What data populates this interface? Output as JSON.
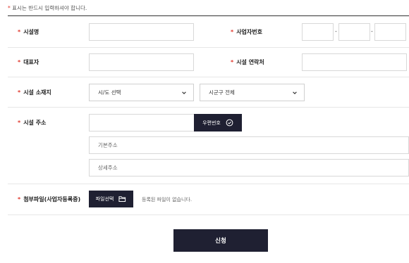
{
  "notice": {
    "star": "*",
    "text": " 표시는 반드시 입력하셔야 합니다."
  },
  "required_mark": "*",
  "fields": {
    "facility_name": {
      "label": "시설명",
      "value": ""
    },
    "business_number": {
      "label": "사업자번호",
      "part1": "",
      "part2": "",
      "part3": "",
      "separator": "-"
    },
    "representative": {
      "label": "대표자",
      "value": ""
    },
    "facility_contact": {
      "label": "시설 연락처",
      "value": ""
    },
    "facility_location": {
      "label": "시설 소재지",
      "city_select": "시/도 선택",
      "district_select": "시군구 전체"
    },
    "facility_address": {
      "label": "시설 주소",
      "postcode": "",
      "postcode_button": "우편번호",
      "basic_address_placeholder": "기본주소",
      "detail_address_placeholder": "상세주소"
    },
    "attachment": {
      "label": "첨부파일(사업자등록증)",
      "button": "파일선택",
      "status": "등록된 파일이 없습니다."
    }
  },
  "submit_label": "신청",
  "icons": {
    "check": "check-circle-icon",
    "folder": "folder-icon",
    "chevron": "chevron-down-icon"
  },
  "colors": {
    "accent": "#1f2032",
    "required": "#e0392e"
  }
}
